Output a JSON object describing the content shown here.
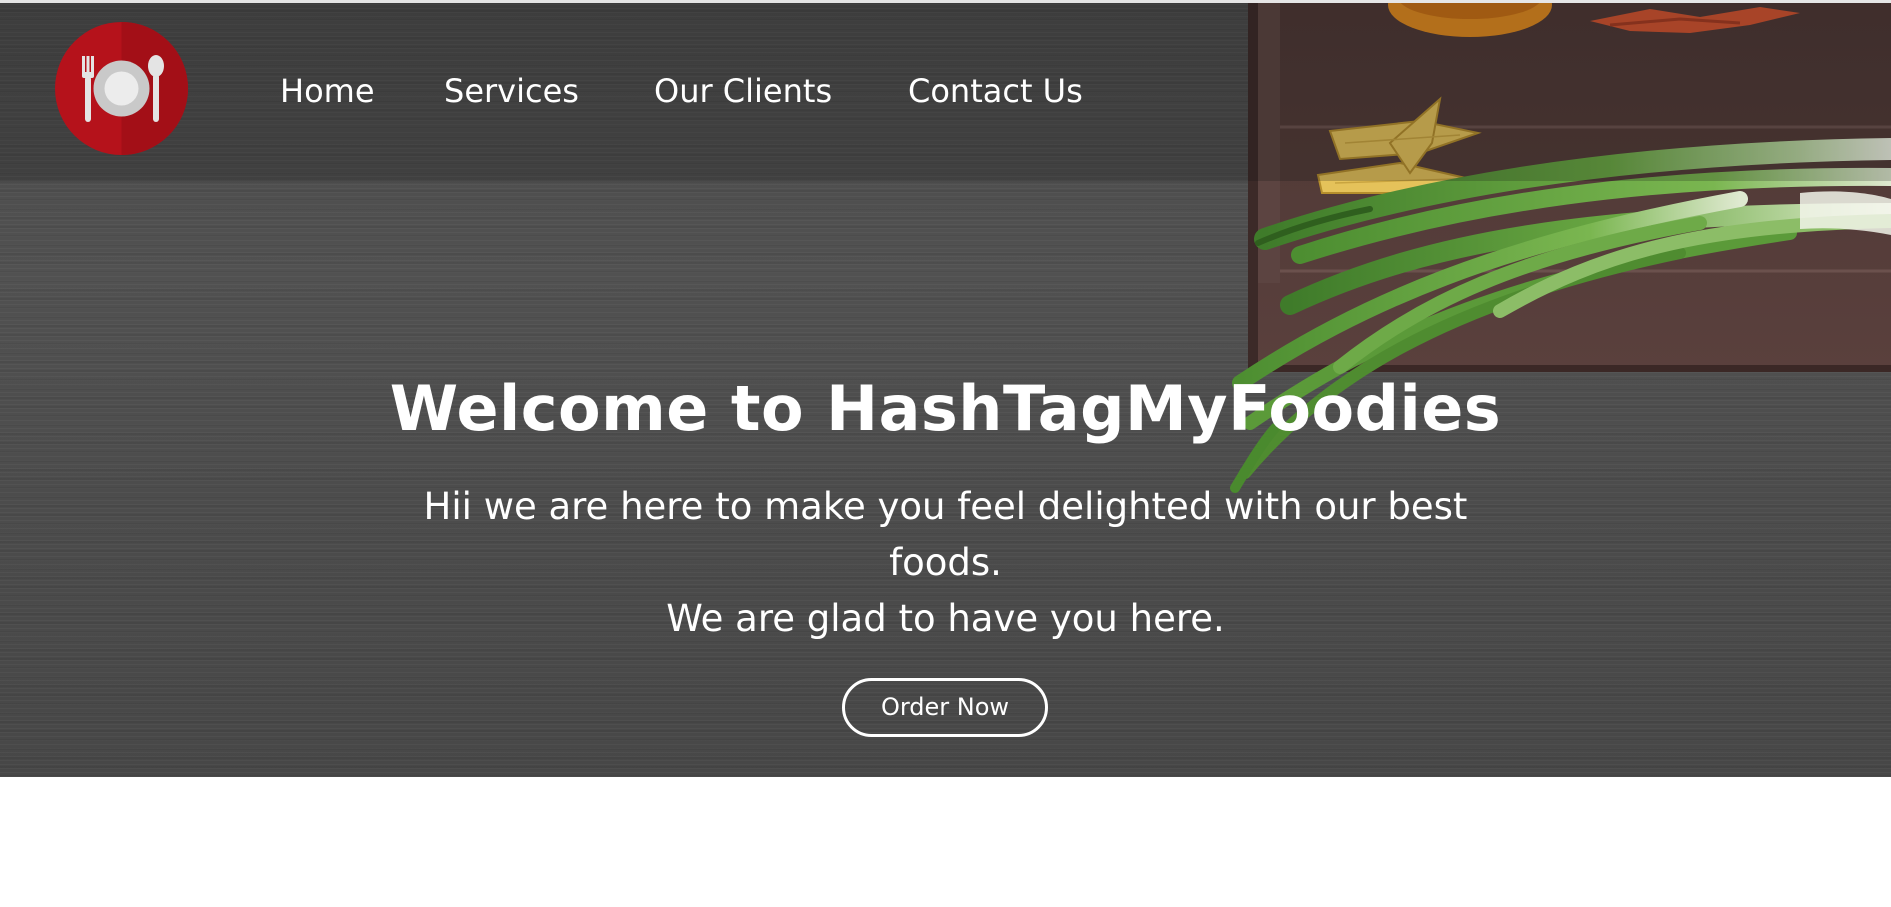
{
  "nav": {
    "links": [
      {
        "label": "Home"
      },
      {
        "label": "Services"
      },
      {
        "label": "Our Clients"
      },
      {
        "label": "Contact Us"
      }
    ]
  },
  "hero": {
    "title": "Welcome to HashTagMyFoodies",
    "line1": "Hii we are here to make you feel delighted with our best foods.",
    "line2": "We are glad to have you here.",
    "button_label": "Order Now"
  },
  "icons": {
    "logo": "plate-fork-spoon-icon"
  },
  "colors": {
    "logo_red": "#b5121b",
    "hero_text": "#ffffff",
    "hero_background": "#4d4d4d"
  }
}
